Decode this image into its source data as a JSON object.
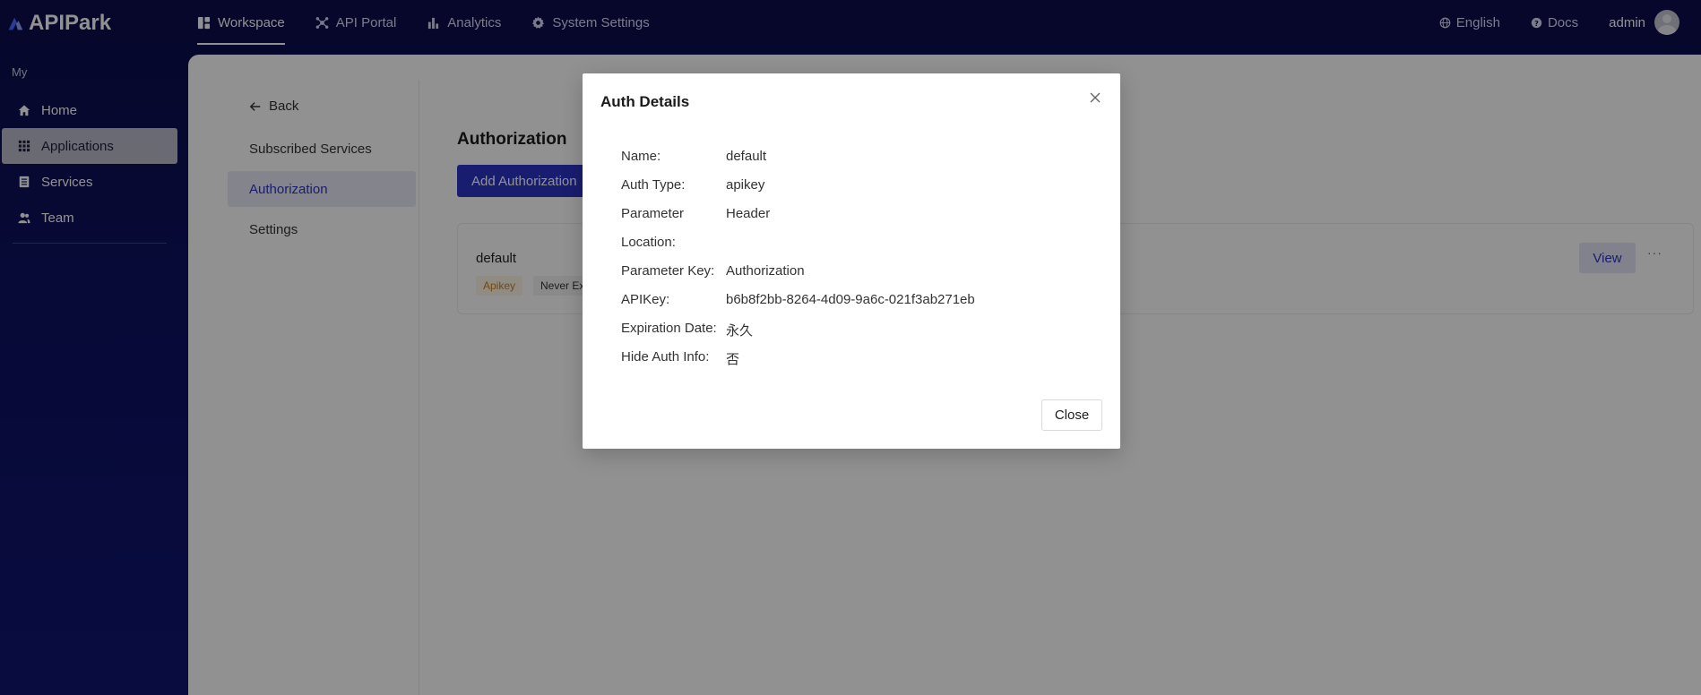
{
  "app": {
    "name": "APIPark"
  },
  "topnav": {
    "items": [
      {
        "label": "Workspace",
        "icon": "dashboard-icon",
        "active": true
      },
      {
        "label": "API Portal",
        "icon": "network-icon",
        "active": false
      },
      {
        "label": "Analytics",
        "icon": "bar-chart-icon",
        "active": false
      },
      {
        "label": "System Settings",
        "icon": "gear-icon",
        "active": false
      }
    ],
    "language": "English",
    "docs": "Docs",
    "user": "admin"
  },
  "sidebar": {
    "heading": "My",
    "items": [
      {
        "label": "Home",
        "icon": "home-icon",
        "active": false
      },
      {
        "label": "Applications",
        "icon": "apps-grid-icon",
        "active": true
      },
      {
        "label": "Services",
        "icon": "services-icon",
        "active": false
      },
      {
        "label": "Team",
        "icon": "team-icon",
        "active": false
      }
    ]
  },
  "subnav": {
    "back": "Back",
    "items": [
      {
        "label": "Subscribed Services",
        "active": false
      },
      {
        "label": "Authorization",
        "active": true
      },
      {
        "label": "Settings",
        "active": false
      }
    ]
  },
  "main": {
    "title": "Authorization",
    "add_button": "Add Authorization",
    "auth_card": {
      "name": "default",
      "type_tag": "Apikey",
      "expire_tag": "Never Expi",
      "view_button": "View",
      "more": "···"
    }
  },
  "modal": {
    "title": "Auth Details",
    "details": [
      {
        "label": "Name:",
        "value": "default"
      },
      {
        "label": "Auth Type:",
        "value": "apikey"
      },
      {
        "label": "Parameter",
        "value": "Header"
      },
      {
        "label": "Location:",
        "value": ""
      },
      {
        "label": "Parameter Key:",
        "value": "Authorization"
      },
      {
        "label": "APIKey:",
        "value": "b6b8f2bb-8264-4d09-9a6c-021f3ab271eb"
      },
      {
        "label": "Expiration Date:",
        "value": "永久"
      },
      {
        "label": "Hide Auth Info:",
        "value": "否"
      }
    ],
    "close_button": "Close"
  },
  "colors": {
    "brand": "#2c33c6",
    "nav_bg": "#0b0d4a",
    "apikey_tag": "#c8811d"
  }
}
